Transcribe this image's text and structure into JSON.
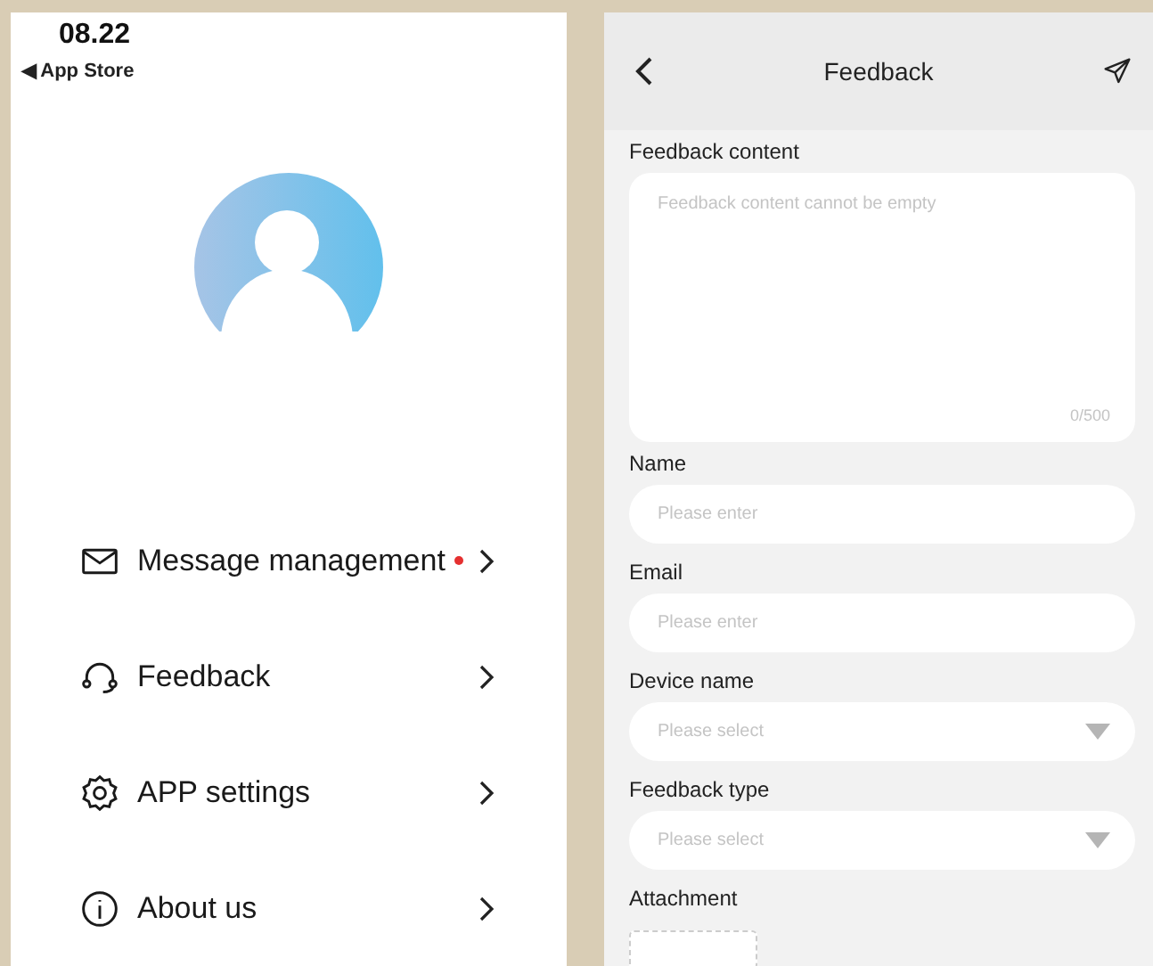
{
  "profile_screen": {
    "status_bar": {
      "time": "08.22",
      "back_link": "◀ App Store"
    },
    "menu": [
      {
        "kind": "mail",
        "label": "Message management",
        "unread": true
      },
      {
        "kind": "headset",
        "label": "Feedback",
        "unread": false
      },
      {
        "kind": "gear",
        "label": "APP settings",
        "unread": false
      },
      {
        "kind": "info",
        "label": "About us",
        "unread": false
      }
    ]
  },
  "feedback_screen": {
    "title": "Feedback",
    "fields": [
      {
        "kind": "textarea",
        "label": "Feedback content",
        "placeholder": "Feedback content cannot be empty",
        "counter": "0/500"
      },
      {
        "kind": "text",
        "label": "Name",
        "placeholder": "Please enter"
      },
      {
        "kind": "text",
        "label": "Email",
        "placeholder": "Please enter"
      },
      {
        "kind": "select",
        "label": "Device name",
        "placeholder": "Please select"
      },
      {
        "kind": "select",
        "label": "Feedback type",
        "placeholder": "Please select"
      },
      {
        "kind": "attachment",
        "label": "Attachment"
      }
    ]
  }
}
